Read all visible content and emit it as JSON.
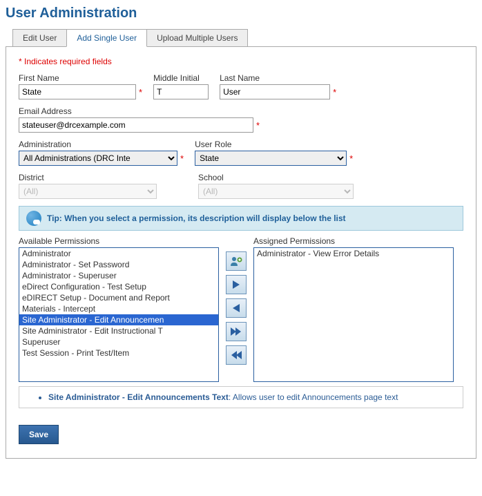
{
  "page_title": "User Administration",
  "tabs": {
    "edit_user": "Edit User",
    "add_single": "Add Single User",
    "upload_multi": "Upload Multiple Users"
  },
  "required_note": "* Indicates required fields",
  "labels": {
    "first_name": "First Name",
    "middle_initial": "Middle Initial",
    "last_name": "Last Name",
    "email": "Email Address",
    "administration": "Administration",
    "user_role": "User Role",
    "district": "District",
    "school": "School",
    "available": "Available Permissions",
    "assigned": "Assigned Permissions"
  },
  "values": {
    "first_name": "State",
    "middle_initial": "T",
    "last_name": "User",
    "email": "stateuser@drcexample.com",
    "administration": "All Administrations (DRC Inte",
    "user_role": "State",
    "district": "(All)",
    "school": "(All)"
  },
  "tip": "Tip: When you select a permission, its description will display below the list",
  "available_permissions": [
    "Administrator",
    "Administrator - Set Password",
    "Administrator - Superuser",
    "eDirect Configuration - Test Setup",
    "eDIRECT Setup - Document and Report",
    "Materials - Intercept",
    "Site Administrator - Edit Announcemen",
    "Site Administrator - Edit Instructional T",
    "Superuser",
    "Test Session - Print Test/Item"
  ],
  "selected_available_index": 6,
  "assigned_permissions": [
    "Administrator - View Error Details"
  ],
  "description": {
    "title": "Site Administrator - Edit Announcements Text",
    "text": ": Allows user to edit Announcements page text"
  },
  "save_label": "Save"
}
